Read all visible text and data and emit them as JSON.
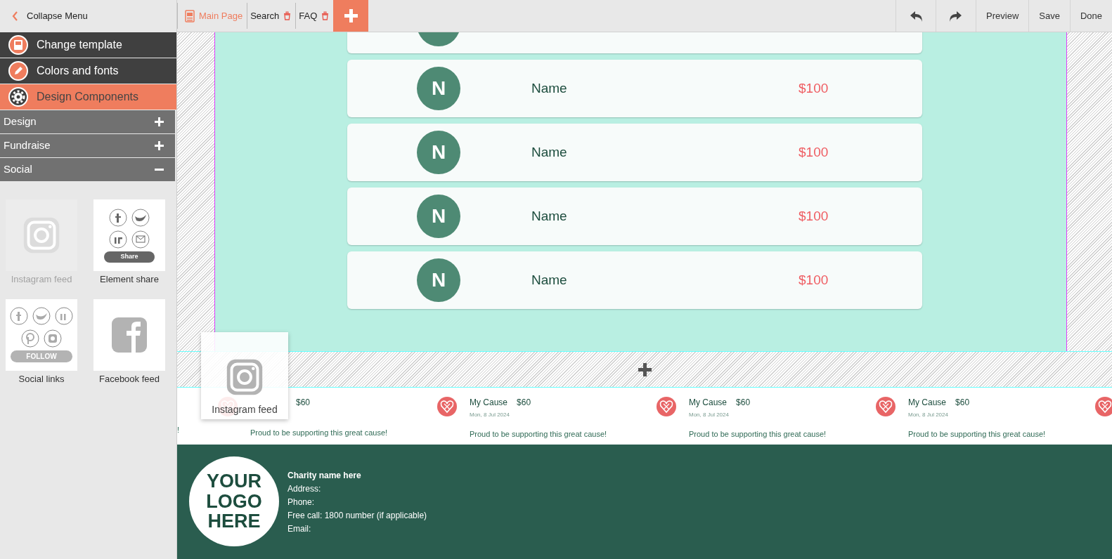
{
  "sidebar": {
    "collapse_label": "Collapse Menu",
    "menu": [
      {
        "label": "Change template",
        "kind": "template",
        "selected": false
      },
      {
        "label": "Colors and fonts",
        "kind": "pencil",
        "selected": false
      },
      {
        "label": "Design Components",
        "kind": "gear",
        "selected": true
      }
    ],
    "sections": [
      {
        "label": "Design",
        "expanded": false
      },
      {
        "label": "Fundraise",
        "expanded": false
      },
      {
        "label": "Social",
        "expanded": true
      }
    ],
    "components": [
      {
        "label": "Instagram feed",
        "kind": "instagram",
        "disabled": true
      },
      {
        "label": "Element share",
        "kind": "share",
        "disabled": false,
        "button_text": "Share"
      },
      {
        "label": "Social links",
        "kind": "follow",
        "disabled": false,
        "button_text": "FOLLOW"
      },
      {
        "label": "Facebook feed",
        "kind": "facebook",
        "disabled": false
      }
    ]
  },
  "tabs": [
    {
      "label": "Main Page",
      "selected": true,
      "deletable": false
    },
    {
      "label": "Search",
      "selected": false,
      "deletable": true
    },
    {
      "label": "FAQ",
      "selected": false,
      "deletable": true
    }
  ],
  "toolbar": {
    "buttons": [
      "Preview",
      "Save",
      "Done"
    ]
  },
  "donors": [
    {
      "initial": "N",
      "name": "Name",
      "amount": "$100"
    },
    {
      "initial": "N",
      "name": "Name",
      "amount": "$100"
    },
    {
      "initial": "N",
      "name": "Name",
      "amount": "$100"
    },
    {
      "initial": "N",
      "name": "Name",
      "amount": "$100"
    }
  ],
  "drag_ghost": {
    "label": "Instagram feed"
  },
  "donations": [
    {
      "kind": "cut",
      "message": "!"
    },
    {
      "kind": "covered",
      "amount": "$60",
      "message": "Proud to be supporting this great cause!"
    },
    {
      "kind": "full",
      "name": "My Cause",
      "amount": "$60",
      "date": "Mon, 8 Jul 2024",
      "message": "Proud to be supporting this great cause!"
    },
    {
      "kind": "full",
      "name": "My Cause",
      "amount": "$60",
      "date": "Mon, 8 Jul 2024",
      "message": "Proud to be supporting this great cause!"
    },
    {
      "kind": "full",
      "name": "My Cause",
      "amount": "$60",
      "date": "Mon, 8 Jul 2024",
      "message": "Proud to be supporting this great cause!"
    },
    {
      "kind": "icon"
    }
  ],
  "footer": {
    "logo_text": "YOUR LOGO HERE",
    "lines": [
      "Charity name here",
      "Address:",
      "Phone:",
      "Free call: 1800 number (if applicable)",
      "Email:"
    ]
  }
}
